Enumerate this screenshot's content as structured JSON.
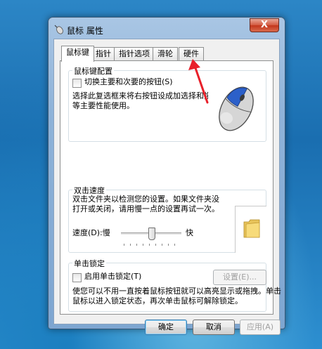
{
  "window": {
    "title": "鼠标 属性",
    "close_glyph": "X"
  },
  "tabs": [
    {
      "label": "鼠标键",
      "active": true
    },
    {
      "label": "指针",
      "active": false
    },
    {
      "label": "指针选项",
      "active": false
    },
    {
      "label": "滑轮",
      "active": false
    },
    {
      "label": "硬件",
      "active": false
    }
  ],
  "button_config": {
    "title": "鼠标键配置",
    "checkbox_label": "切换主要和次要的按钮(S)",
    "checked": false,
    "description_line1": "选择此复选框来将右按钮设成加选择和拖放",
    "description_line2": "等主要性能使用。"
  },
  "double_click": {
    "title": "双击速度",
    "description_line1": "双击文件夹以检测您的设置。如果文件夹没",
    "description_line2": "打开或关闭，请用慢一点的设置再试一次。",
    "speed_label": "速度(D):慢",
    "fast_label": "快",
    "slider_position": 0.5
  },
  "click_lock": {
    "title": "单击锁定",
    "checkbox_label": "启用单击锁定(T)",
    "checked": false,
    "settings_button": "设置(E)...",
    "description_line1": "使您可以不用一直按着鼠标按钮就可以高亮显示或拖拽。单击",
    "description_line2": "鼠标以进入锁定状态，再次单击鼠标可解除锁定。"
  },
  "footer": {
    "ok": "确定",
    "cancel": "取消",
    "apply": "应用(A)"
  },
  "annotation": {
    "arrow_color": "#e8202a"
  }
}
